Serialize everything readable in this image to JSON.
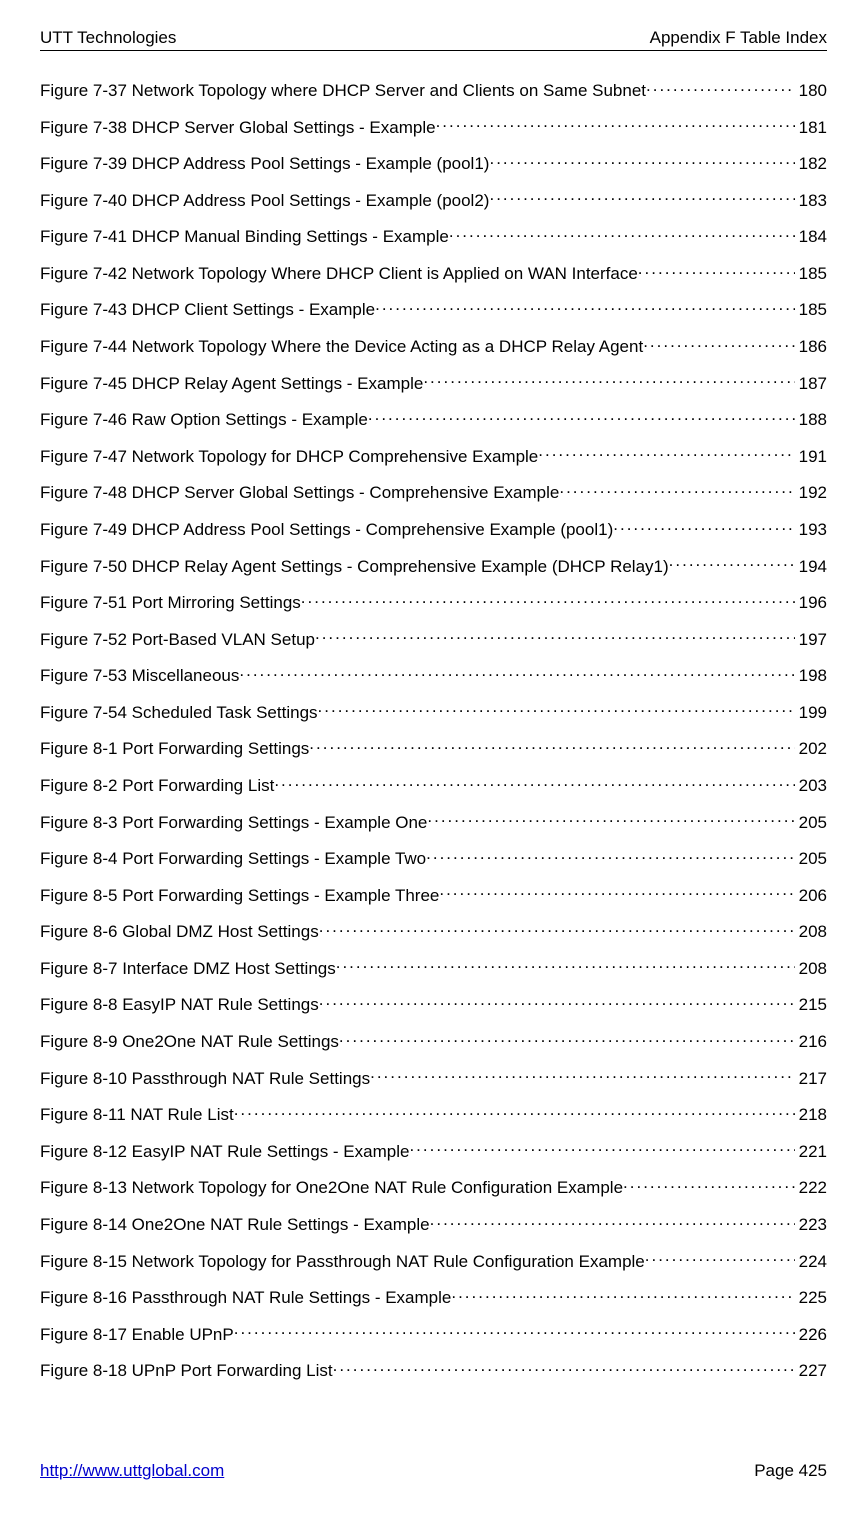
{
  "header": {
    "left": "UTT Technologies",
    "right": "Appendix F Table Index"
  },
  "entries": [
    {
      "label": "Figure 7-37 Network Topology where DHCP Server and Clients on Same Subnet",
      "page": "180"
    },
    {
      "label": "Figure 7-38 DHCP Server Global Settings - Example",
      "page": "181"
    },
    {
      "label": "Figure 7-39 DHCP Address Pool Settings - Example (pool1) ",
      "page": "182"
    },
    {
      "label": "Figure 7-40 DHCP Address Pool Settings - Example (pool2) ",
      "page": "183"
    },
    {
      "label": "Figure 7-41 DHCP Manual Binding Settings - Example",
      "page": "184"
    },
    {
      "label": "Figure 7-42 Network Topology Where DHCP Client is Applied on WAN Interface",
      "page": "185"
    },
    {
      "label": "Figure 7-43 DHCP Client Settings - Example",
      "page": "185"
    },
    {
      "label": "Figure 7-44 Network Topology Where the Device Acting as a DHCP Relay Agent ",
      "page": "186"
    },
    {
      "label": "Figure 7-45 DHCP Relay Agent Settings - Example ",
      "page": "187"
    },
    {
      "label": "Figure 7-46 Raw Option Settings - Example ",
      "page": "188"
    },
    {
      "label": "Figure 7-47 Network Topology for DHCP Comprehensive Example",
      "page": "191"
    },
    {
      "label": "Figure 7-48 DHCP Server Global Settings - Comprehensive Example ",
      "page": "192"
    },
    {
      "label": "Figure 7-49 DHCP Address Pool Settings - Comprehensive Example (pool1)",
      "page": "193"
    },
    {
      "label": "Figure 7-50 DHCP Relay Agent Settings - Comprehensive Example (DHCP Relay1) ",
      "page": "194"
    },
    {
      "label": "Figure 7-51 Port Mirroring Settings ",
      "page": "196"
    },
    {
      "label": "Figure 7-52 Port-Based VLAN Setup ",
      "page": "197"
    },
    {
      "label": "Figure 7-53 Miscellaneous ",
      "page": "198"
    },
    {
      "label": "Figure 7-54 Scheduled Task Settings",
      "page": "199"
    },
    {
      "label": "Figure 8-1 Port Forwarding Settings",
      "page": "202"
    },
    {
      "label": "Figure 8-2 Port Forwarding List ",
      "page": "203"
    },
    {
      "label": "Figure 8-3 Port Forwarding Settings - Example One ",
      "page": "205"
    },
    {
      "label": "Figure 8-4 Port Forwarding Settings - Example Two",
      "page": "205"
    },
    {
      "label": "Figure 8-5 Port Forwarding Settings - Example Three",
      "page": "206"
    },
    {
      "label": "Figure 8-6 Global DMZ Host Settings",
      "page": "208"
    },
    {
      "label": "Figure 8-7 Interface DMZ Host Settings ",
      "page": "208"
    },
    {
      "label": "Figure 8-8 EasyIP NAT Rule Settings",
      "page": "215"
    },
    {
      "label": "Figure 8-9 One2One NAT Rule Settings ",
      "page": "216"
    },
    {
      "label": "Figure 8-10 Passthrough NAT Rule Settings",
      "page": "217"
    },
    {
      "label": "Figure 8-11 NAT Rule List",
      "page": "218"
    },
    {
      "label": "Figure 8-12 EasyIP NAT Rule Settings - Example ",
      "page": "221"
    },
    {
      "label": "Figure 8-13 Network Topology for One2One NAT Rule Configuration Example",
      "page": "222"
    },
    {
      "label": "Figure 8-14 One2One NAT Rule Settings - Example",
      "page": "223"
    },
    {
      "label": "Figure 8-15 Network Topology for Passthrough NAT Rule Configuration Example ",
      "page": "224"
    },
    {
      "label": "Figure 8-16 Passthrough NAT Rule Settings - Example ",
      "page": "225"
    },
    {
      "label": "Figure 8-17 Enable UPnP",
      "page": "226"
    },
    {
      "label": "Figure 8-18 UPnP Port Forwarding List",
      "page": "227"
    }
  ],
  "footer": {
    "link_text": "http://www.uttglobal.com",
    "page_label": "Page 425"
  }
}
